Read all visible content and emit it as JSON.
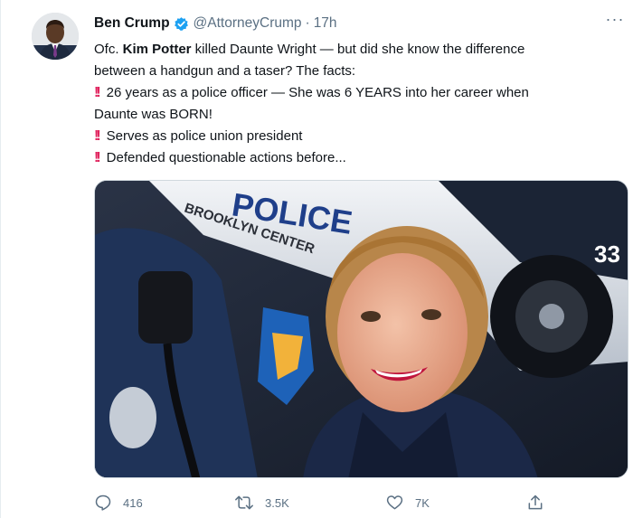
{
  "tweet": {
    "author_name": "Ben Crump",
    "handle": "@AttorneyCrump",
    "separator": "·",
    "time": "17h",
    "more": "···",
    "line1_prefix": "Ofc. ",
    "line1_bold": "Kim Potter",
    "line1_rest": " killed Daunte Wright — but did she know the difference",
    "line2": "between a handgun and a taser? The facts:",
    "bullet_glyph": "!!",
    "bullet1_a": "26 years as a police officer — She was 6 YEARS into her career when",
    "bullet1_b": "Daunte was BORN!",
    "bullet2": "Serves as police union president",
    "bullet3": "Defended questionable actions before...",
    "image_text": {
      "car_lettering": "POLICE",
      "car_sub": "BROOKLYN CENTER",
      "car_number": "33"
    }
  },
  "actions": {
    "reply_count": "416",
    "retweet_count": "3.5K",
    "like_count": "7K"
  },
  "colors": {
    "accent": "#1da1f2",
    "muted": "#5b7083",
    "exclaim": "#e0245e"
  }
}
